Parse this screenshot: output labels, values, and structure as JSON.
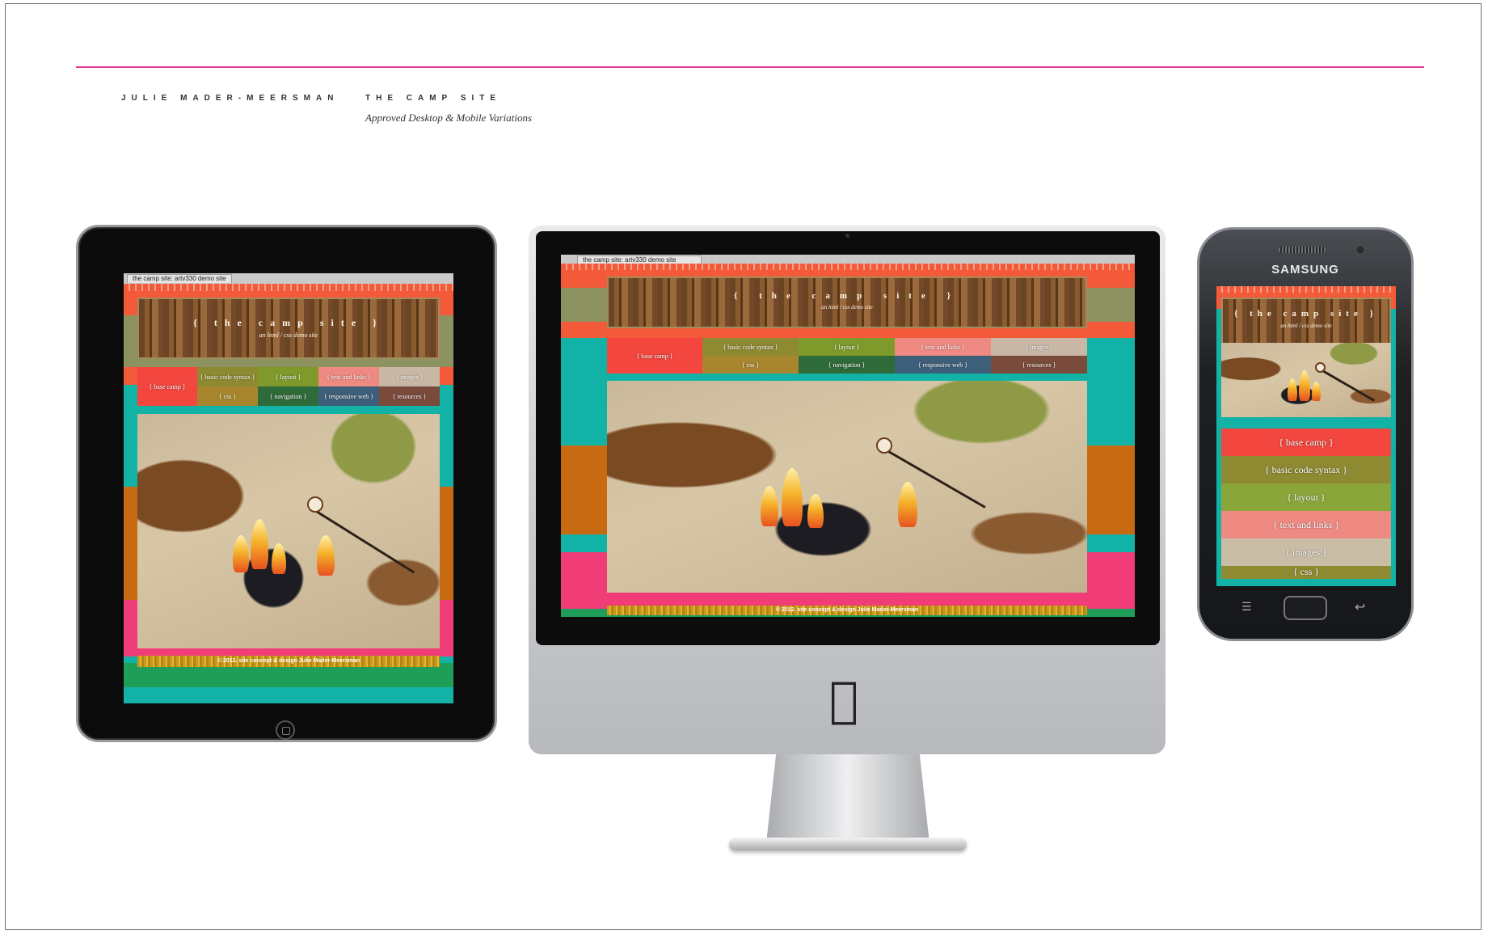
{
  "header": {
    "author": "JULIE MADER-MEERSMAN",
    "project_title": "THE CAMP SITE",
    "project_subtitle": "Approved Desktop & Mobile Variations"
  },
  "site": {
    "browser_tab": "the camp site: artv330 demo site",
    "title": "{ the camp site }",
    "subtitle": "an html / css demo site",
    "footer": "© 2012. site concept & design Julie Mader-Meersman",
    "nav": [
      "{ base camp }",
      "{ basic code syntax }",
      "{ layout }",
      "{ text and links }",
      "{ images }",
      "{ css }",
      "{ navigation }",
      "{ responsive web }",
      "{ resources }"
    ],
    "phone_nav": [
      "{ base camp }",
      "{ basic code syntax }",
      "{ layout }",
      "{ text and links }",
      "{ images }",
      "{ css }"
    ]
  },
  "devices": {
    "phone_brand": "SAMSUNG"
  },
  "colors": {
    "accent_rule": "#e6368f",
    "teal": "#12b3a6",
    "olive": "#8d9360",
    "orange": "#c76a12",
    "pink": "#f03d78",
    "coral": "#f25a3a"
  }
}
